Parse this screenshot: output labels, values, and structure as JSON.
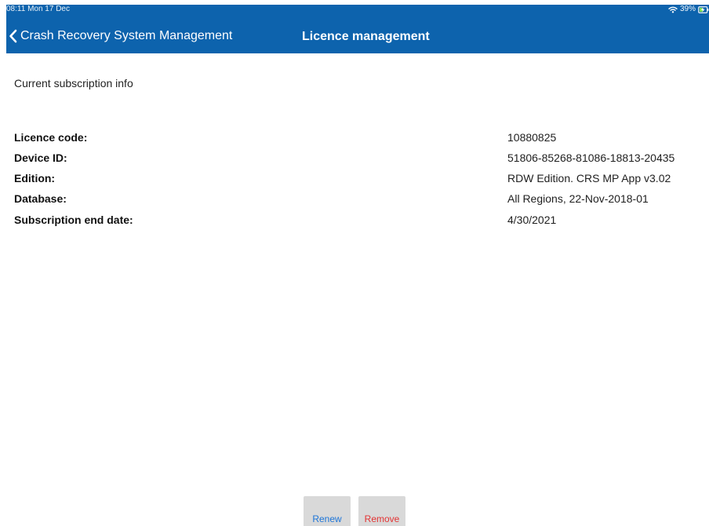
{
  "status_bar": {
    "time": "08:11",
    "date": "Mon 17 Dec",
    "battery": "39%",
    "wifi_icon": "wifi-icon",
    "battery_icon": "battery-charging-icon"
  },
  "nav_bar": {
    "back_label": "Crash Recovery System Management",
    "back_icon": "chevron-left-icon",
    "title": "Licence management",
    "background": "#0d63ad"
  },
  "content": {
    "section_title": "Current subscription info",
    "rows": [
      {
        "label": "Licence code:",
        "value": "10880825"
      },
      {
        "label": "Device ID:",
        "value": "51806-85268-81086-18813-20435"
      },
      {
        "label": "Edition:",
        "value": "RDW Edition. CRS MP App v3.02"
      },
      {
        "label": "Database:",
        "value": "All Regions, 22-Nov-2018-01"
      },
      {
        "label": "Subscription end date:",
        "value": "4/30/2021"
      }
    ]
  },
  "buttons": {
    "renew": "Renew",
    "remove": "Remove",
    "renew_color": "#1d75d8",
    "remove_color": "#e33434",
    "button_background": "#d9d9d9"
  }
}
